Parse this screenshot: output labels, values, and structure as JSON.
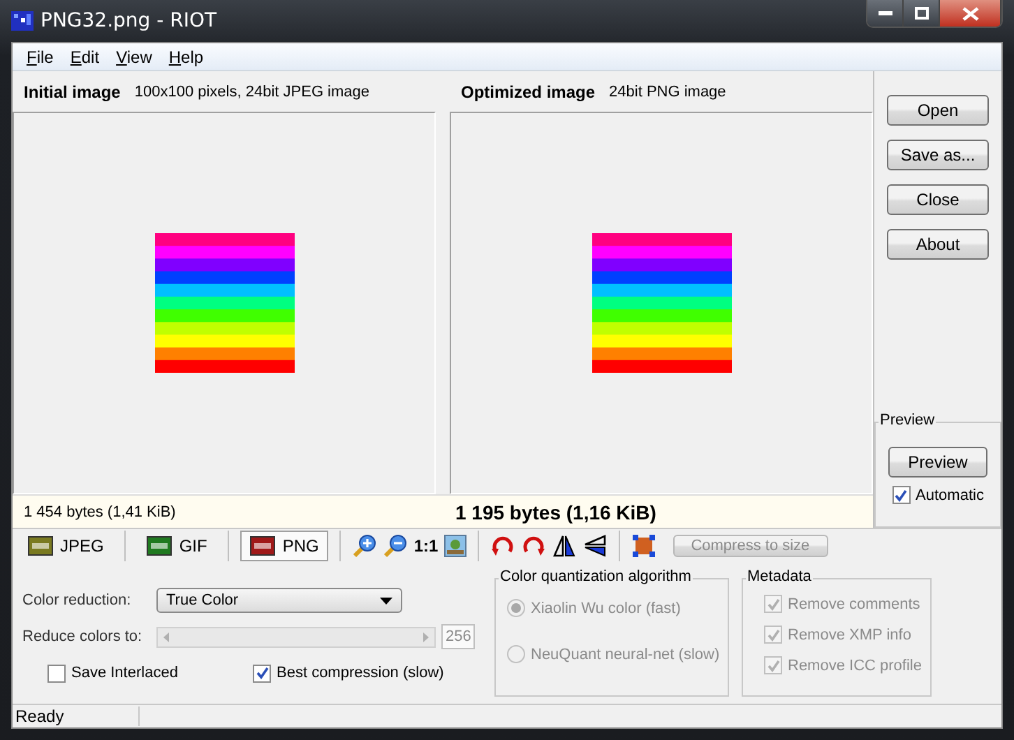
{
  "window": {
    "title": "PNG32.png - RIOT"
  },
  "menu": [
    {
      "label": "File"
    },
    {
      "label": "Edit"
    },
    {
      "label": "View"
    },
    {
      "label": "Help"
    }
  ],
  "initial_image": {
    "label": "Initial image",
    "info": "100x100 pixels, 24bit JPEG image",
    "size": "1 454 bytes (1,41 KiB)"
  },
  "optimized_image": {
    "label": "Optimized image",
    "info": "24bit PNG image",
    "size": "1 195 bytes (1,16 KiB)"
  },
  "side_buttons": [
    "Open",
    "Save as...",
    "Close",
    "About"
  ],
  "preview_group": {
    "title": "Preview",
    "button": "Preview",
    "automatic": {
      "label": "Automatic",
      "checked": true
    }
  },
  "format_tabs": [
    {
      "label": "JPEG",
      "kind": "jpeg",
      "selected": false
    },
    {
      "label": "GIF",
      "kind": "gif",
      "selected": false
    },
    {
      "label": "PNG",
      "kind": "png",
      "selected": true
    }
  ],
  "toolbar": {
    "zoom_ratio": "1:1",
    "compress_button": {
      "label": "Compress to size",
      "disabled": true
    }
  },
  "png_options": {
    "color_reduction": {
      "label": "Color reduction:",
      "value": "True Color"
    },
    "reduce_colors": {
      "label": "Reduce colors to:",
      "value": "256",
      "disabled": true
    },
    "save_interlaced": {
      "label": "Save Interlaced",
      "checked": false
    },
    "best_compression": {
      "label": "Best compression (slow)",
      "checked": true
    }
  },
  "quantization": {
    "title": "Color quantization algorithm",
    "options": [
      {
        "label": "Xiaolin Wu color (fast)",
        "selected": true,
        "disabled": true
      },
      {
        "label": "NeuQuant neural-net (slow)",
        "selected": false,
        "disabled": true
      }
    ]
  },
  "metadata": {
    "title": "Metadata",
    "options": [
      {
        "label": "Remove comments",
        "checked": true,
        "disabled": true
      },
      {
        "label": "Remove XMP info",
        "checked": true,
        "disabled": true
      },
      {
        "label": "Remove ICC profile",
        "checked": true,
        "disabled": true
      }
    ]
  },
  "status_bar": "Ready"
}
